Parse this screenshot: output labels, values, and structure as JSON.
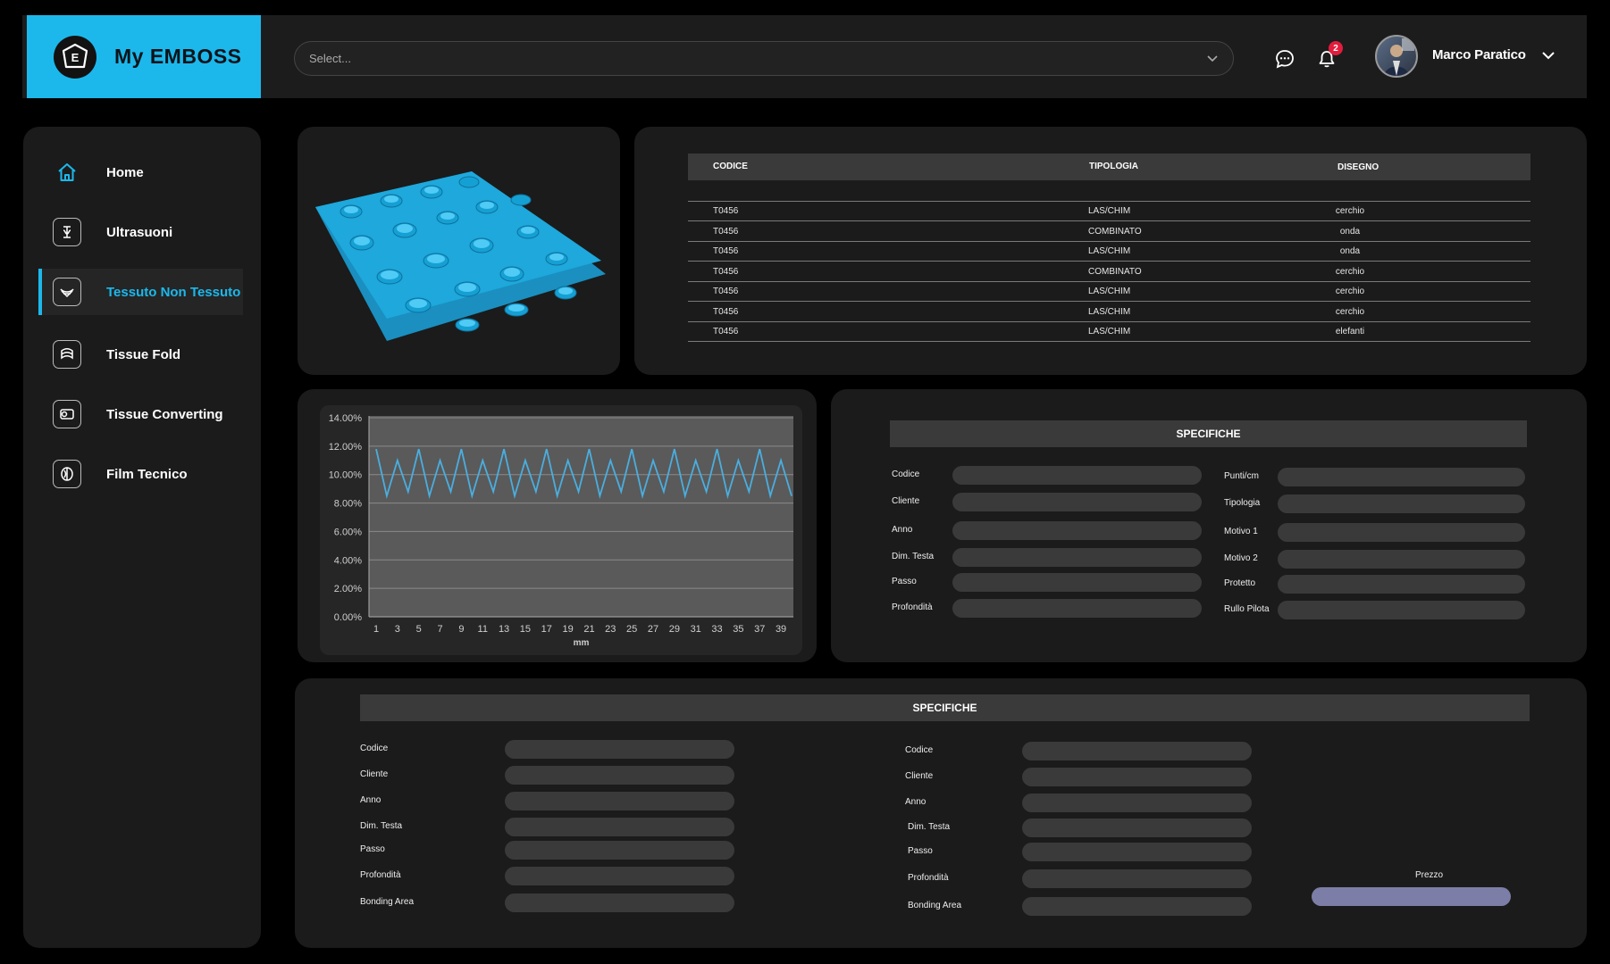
{
  "header": {
    "brand_name": "My EMBOSS",
    "logo_letter": "E",
    "select_placeholder": "Select...",
    "notification_count": "2",
    "user_name": "Marco Paratico"
  },
  "sidebar": {
    "items": [
      {
        "label": "Home",
        "icon": "home-icon",
        "active": false
      },
      {
        "label": "Ultrasuoni",
        "icon": "ultrasound-icon",
        "active": false
      },
      {
        "label": "Tessuto Non Tessuto",
        "icon": "nonwoven-icon",
        "active": true
      },
      {
        "label": "Tissue Fold",
        "icon": "tissue-fold-icon",
        "active": false
      },
      {
        "label": "Tissue Converting",
        "icon": "tissue-converting-icon",
        "active": false
      },
      {
        "label": "Film Tecnico",
        "icon": "film-icon",
        "active": false
      }
    ]
  },
  "table": {
    "columns": [
      "CODICE",
      "TIPOLOGIA",
      "DISEGNO"
    ],
    "rows": [
      [
        "T0456",
        "LAS/CHIM",
        "cerchio"
      ],
      [
        "T0456",
        "COMBINATO",
        "onda"
      ],
      [
        "T0456",
        "LAS/CHIM",
        "onda"
      ],
      [
        "T0456",
        "COMBINATO",
        "cerchio"
      ],
      [
        "T0456",
        "LAS/CHIM",
        "cerchio"
      ],
      [
        "T0456",
        "LAS/CHIM",
        "cerchio"
      ],
      [
        "T0456",
        "LAS/CHIM",
        "elefanti"
      ]
    ]
  },
  "chart_data": {
    "type": "line",
    "xlabel": "mm",
    "ylabel": "",
    "title": "",
    "ylim": [
      0,
      14
    ],
    "y_ticks": [
      "0.00%",
      "2.00%",
      "4.00%",
      "6.00%",
      "8.00%",
      "10.00%",
      "12.00%",
      "14.00%"
    ],
    "x_tick_labels": [
      "1",
      "3",
      "5",
      "7",
      "9",
      "11",
      "13",
      "15",
      "17",
      "19",
      "21",
      "23",
      "25",
      "27",
      "29",
      "31",
      "33",
      "35",
      "37",
      "39"
    ],
    "series": [
      {
        "color": "#4aaee0",
        "x": [
          1,
          2,
          3,
          4,
          5,
          6,
          7,
          8,
          9,
          10,
          11,
          12,
          13,
          14,
          15,
          16,
          17,
          18,
          19,
          20,
          21,
          22,
          23,
          24,
          25,
          26,
          27,
          28,
          29,
          30,
          31,
          32,
          33,
          34,
          35,
          36,
          37,
          38,
          39,
          40
        ],
        "values": [
          11.8,
          8.5,
          11.0,
          8.8,
          11.8,
          8.5,
          11.0,
          8.8,
          11.8,
          8.5,
          11.0,
          8.8,
          11.8,
          8.5,
          11.0,
          8.8,
          11.8,
          8.5,
          11.0,
          8.8,
          11.8,
          8.5,
          11.0,
          8.8,
          11.8,
          8.5,
          11.0,
          8.8,
          11.8,
          8.5,
          11.0,
          8.8,
          11.8,
          8.5,
          11.0,
          8.8,
          11.8,
          8.5,
          11.0,
          8.5
        ]
      }
    ],
    "grid": true
  },
  "specs_right": {
    "title": "SPECIFICHE",
    "left_labels": [
      "Codice",
      "Cliente",
      "Anno",
      "Dim. Testa",
      "Passo",
      "Profondità"
    ],
    "right_labels": [
      "Punti/cm",
      "Tipologia",
      "Motivo 1",
      "Motivo 2",
      "Protetto",
      "Rullo Pilota"
    ]
  },
  "specs_bottom": {
    "title": "SPECIFICHE",
    "col1_labels": [
      "Codice",
      "Cliente",
      "Anno",
      "Dim. Testa",
      "Passo",
      "Profondità",
      "Bonding Area"
    ],
    "col2_labels": [
      "Codice",
      "Cliente",
      "Anno",
      "Dim. Testa",
      "Passo",
      "Profondità",
      "Bonding Area"
    ],
    "price_label": "Prezzo"
  },
  "colors": {
    "accent": "#1cb8ec",
    "emboss": "#1eaedc",
    "price_field": "#7c7ea7"
  }
}
